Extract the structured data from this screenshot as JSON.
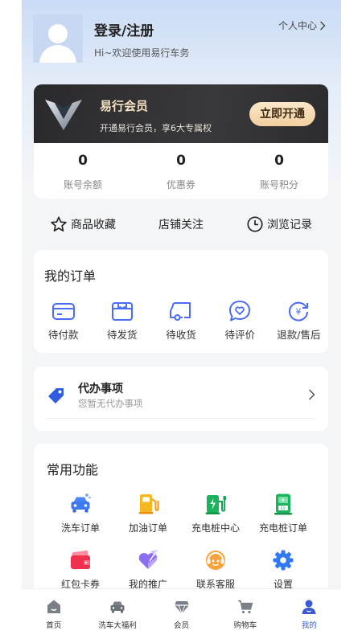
{
  "profile": {
    "title": "登录/注册",
    "welcome": "Hi~欢迎使用易行车务",
    "personal_center": "个人中心"
  },
  "member": {
    "title": "易行会员",
    "subtitle": "开通易行会员，享6大专属权",
    "open_button": "立即开通",
    "stats": [
      {
        "value": "0",
        "label": "账号余额"
      },
      {
        "value": "0",
        "label": "优惠券"
      },
      {
        "value": "0",
        "label": "账号积分"
      }
    ]
  },
  "quicklinks": [
    {
      "label": "商品收藏",
      "icon": "star-icon"
    },
    {
      "label": "店铺关注",
      "icon": ""
    },
    {
      "label": "浏览记录",
      "icon": "clock-icon"
    }
  ],
  "orders": {
    "title": "我的订单",
    "items": [
      {
        "label": "待付款",
        "icon": "card-icon"
      },
      {
        "label": "待发货",
        "icon": "box-icon"
      },
      {
        "label": "待收货",
        "icon": "truck-icon"
      },
      {
        "label": "待评价",
        "icon": "heart-chat-icon"
      },
      {
        "label": "退款/售后",
        "icon": "refund-icon"
      }
    ]
  },
  "todo": {
    "title": "代办事项",
    "subtitle": "您暂无代办事项"
  },
  "functions": {
    "title": "常用功能",
    "items": [
      {
        "label": "洗车订单",
        "icon": "car-wash-icon"
      },
      {
        "label": "加油订单",
        "icon": "fuel-icon"
      },
      {
        "label": "充电桩中心",
        "icon": "charging-icon"
      },
      {
        "label": "充电桩订单",
        "icon": "charge-order-icon"
      },
      {
        "label": "红包卡券",
        "icon": "wallet-icon"
      },
      {
        "label": "我的推广",
        "icon": "promo-icon"
      },
      {
        "label": "联系客服",
        "icon": "service-icon"
      },
      {
        "label": "设置",
        "icon": "gear-icon"
      }
    ]
  },
  "tabs": [
    {
      "label": "首页",
      "icon": "home-icon"
    },
    {
      "label": "洗车大福利",
      "icon": "car-icon"
    },
    {
      "label": "会员",
      "icon": "diamond-icon"
    },
    {
      "label": "购物车",
      "icon": "cart-icon"
    },
    {
      "label": "我的",
      "icon": "user-icon",
      "active": true
    }
  ],
  "colors": {
    "accent": "#3a5ad8",
    "gold": "#f1cf9f",
    "icon_blue": "#4a6cf7"
  }
}
